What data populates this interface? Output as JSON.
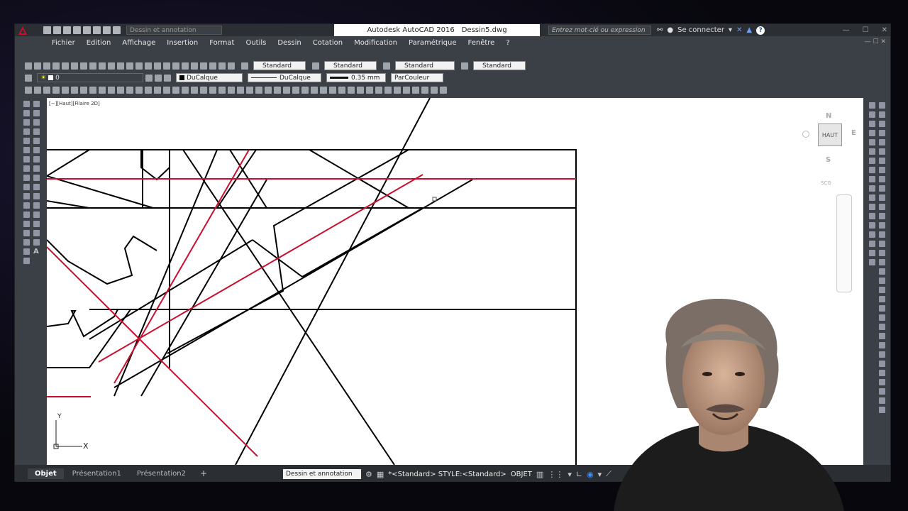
{
  "titlebar": {
    "workspace": "Dessin et annotation",
    "app_name": "Autodesk AutoCAD 2016",
    "file_name": "Dessin5.dwg",
    "search_placeholder": "Entrez mot-clé ou expression",
    "connect": "Se connecter",
    "help": "?"
  },
  "menu": {
    "items": [
      "Fichier",
      "Edition",
      "Affichage",
      "Insertion",
      "Format",
      "Outils",
      "Dessin",
      "Cotation",
      "Modification",
      "Paramétrique",
      "Fenêtre",
      "?"
    ]
  },
  "styles": {
    "text_style": "Standard",
    "dim_style": "Standard",
    "table_style": "Standard",
    "mleader_style": "Standard"
  },
  "layers": {
    "current_layer": "0",
    "color": "DuCalque",
    "linetype": "DuCalque",
    "lineweight": "0.35 mm",
    "plot_style": "ParCouleur"
  },
  "viewport": {
    "label": "[−][Haut][Filaire 2D]"
  },
  "viewcube": {
    "north": "N",
    "south": "S",
    "east": "E",
    "west": "O",
    "face": "HAUT",
    "ucs": "SCG"
  },
  "ucs_icon": {
    "x": "X",
    "y": "Y"
  },
  "tabs": {
    "model": "Objet",
    "layout1": "Présentation1",
    "layout2": "Présentation2",
    "add": "+"
  },
  "status": {
    "workspace": "Dessin et annotation",
    "style_info": "*<Standard> STYLE:<Standard>",
    "mode": "OBJET"
  },
  "colors": {
    "accent_red": "#c8102e",
    "line_black": "#000000",
    "bg_dark": "#3b3f46"
  }
}
